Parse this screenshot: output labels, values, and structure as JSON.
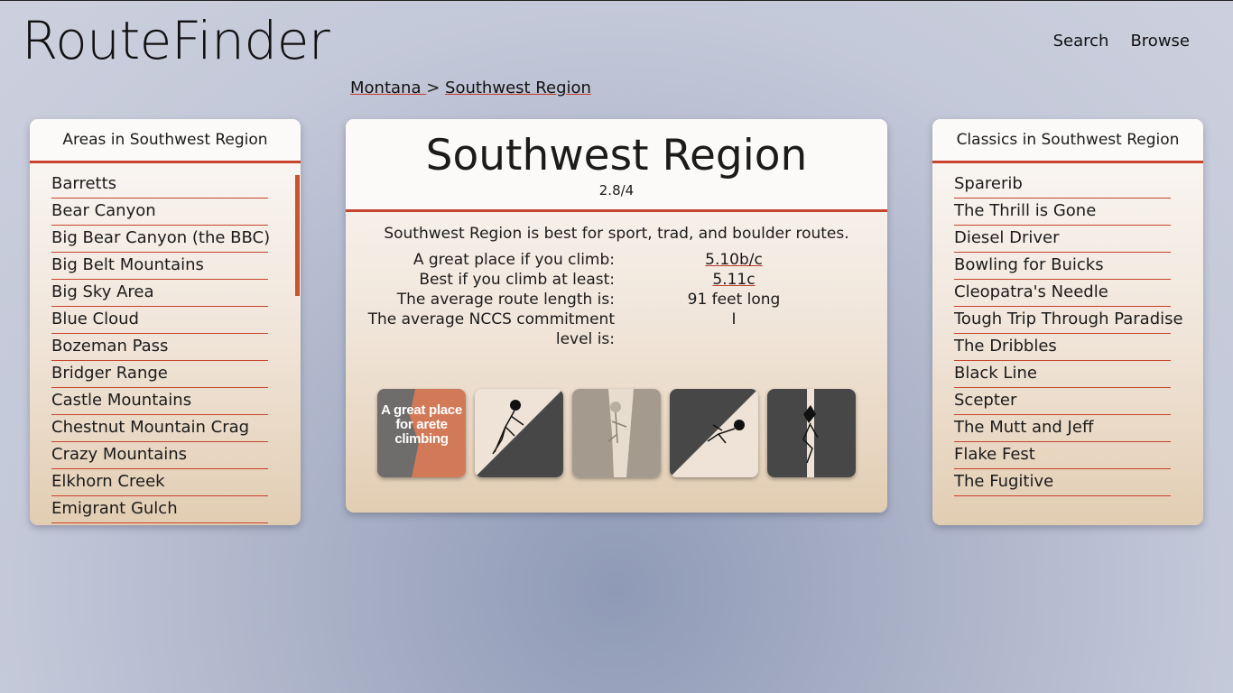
{
  "header": {
    "logo": "RouteFinder",
    "nav": [
      "Search",
      "Browse"
    ]
  },
  "breadcrumb": {
    "parent": "Montana ",
    "separator": ">",
    "current": "Southwest Region"
  },
  "areas": {
    "title": "Areas in Southwest Region",
    "items": [
      "Barretts",
      "Bear Canyon",
      "Big Bear Canyon (the BBC)",
      "Big Belt Mountains",
      "Big Sky Area",
      "Blue Cloud",
      "Bozeman Pass",
      "Bridger Range",
      "Castle Mountains",
      "Chestnut Mountain Crag",
      "Crazy Mountains",
      "Elkhorn Creek",
      "Emigrant Gulch"
    ]
  },
  "main": {
    "title": "Southwest Region",
    "rating": "2.8/4",
    "summary": "Southwest Region is best for sport, trad, and boulder routes.",
    "stats": [
      {
        "label": "A great place if you climb:",
        "value": "5.10b/c"
      },
      {
        "label": "Best if you climb at least:",
        "value": "5.11c"
      },
      {
        "label": "The average route length is:",
        "value": "91 feet long"
      },
      {
        "label": "The average NCCS commitment level is:",
        "value": "I"
      }
    ],
    "icons": [
      {
        "name": "arete-icon",
        "caption": "A great place for arete climbing"
      },
      {
        "name": "slab-icon"
      },
      {
        "name": "chimney-icon"
      },
      {
        "name": "overhang-icon"
      },
      {
        "name": "crack-icon"
      }
    ]
  },
  "classics": {
    "title": "Classics in Southwest Region",
    "items": [
      "Sparerib",
      "The Thrill is Gone",
      "Diesel Driver",
      "Bowling for Buicks",
      "Cleopatra's Needle",
      "Tough Trip Through Paradise",
      "The Dribbles",
      "Black Line",
      "Scepter",
      "The Mutt and Jeff",
      "Flake Fest",
      "The Fugitive"
    ]
  },
  "colors": {
    "accent": "#c8432d",
    "dark": "#474747",
    "tan": "#a49a8e",
    "cream": "#eee3d6"
  }
}
